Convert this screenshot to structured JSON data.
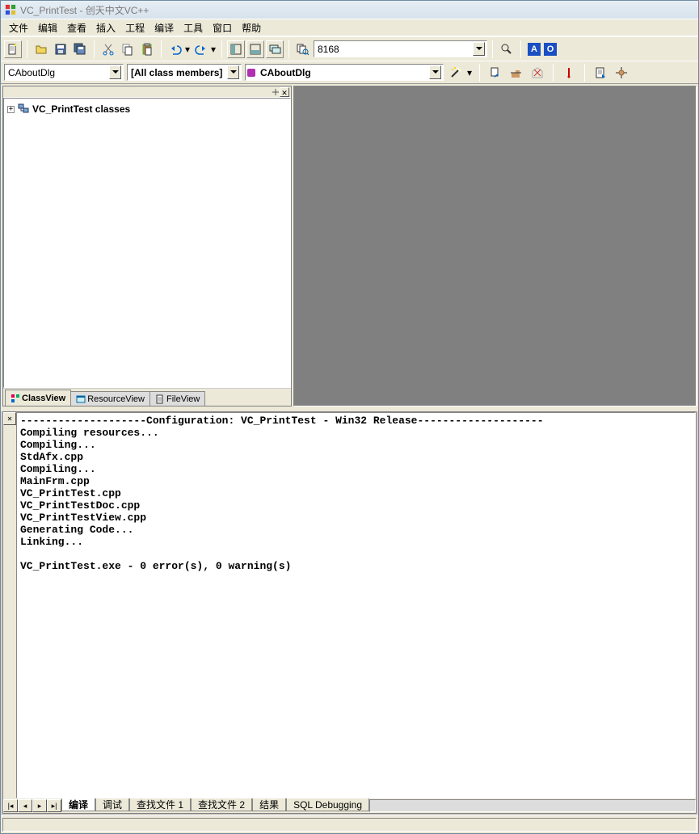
{
  "window": {
    "title": "VC_PrintTest - 创天中文VC++"
  },
  "menu": [
    "文件",
    "编辑",
    "查看",
    "插入",
    "工程",
    "编译",
    "工具",
    "窗口",
    "帮助"
  ],
  "toolbar2": {
    "combo_value": "8168"
  },
  "badges": {
    "a": "A",
    "o": "O"
  },
  "wizard": {
    "class_combo": "CAboutDlg",
    "filter_combo": "[All class members]",
    "member_combo": "CAboutDlg"
  },
  "tree": {
    "root_label": "VC_PrintTest classes"
  },
  "left_tabs": {
    "class": "ClassView",
    "resource": "ResourceView",
    "file": "FileView"
  },
  "output": {
    "lines": [
      "--------------------Configuration: VC_PrintTest - Win32 Release--------------------",
      "Compiling resources...",
      "Compiling...",
      "StdAfx.cpp",
      "Compiling...",
      "MainFrm.cpp",
      "VC_PrintTest.cpp",
      "VC_PrintTestDoc.cpp",
      "VC_PrintTestView.cpp",
      "Generating Code...",
      "Linking...",
      "",
      "VC_PrintTest.exe - 0 error(s), 0 warning(s)"
    ],
    "tabs": [
      "编译",
      "调试",
      "查找文件 1",
      "查找文件 2",
      "结果",
      "SQL Debugging"
    ]
  },
  "status": {
    "main": ""
  }
}
